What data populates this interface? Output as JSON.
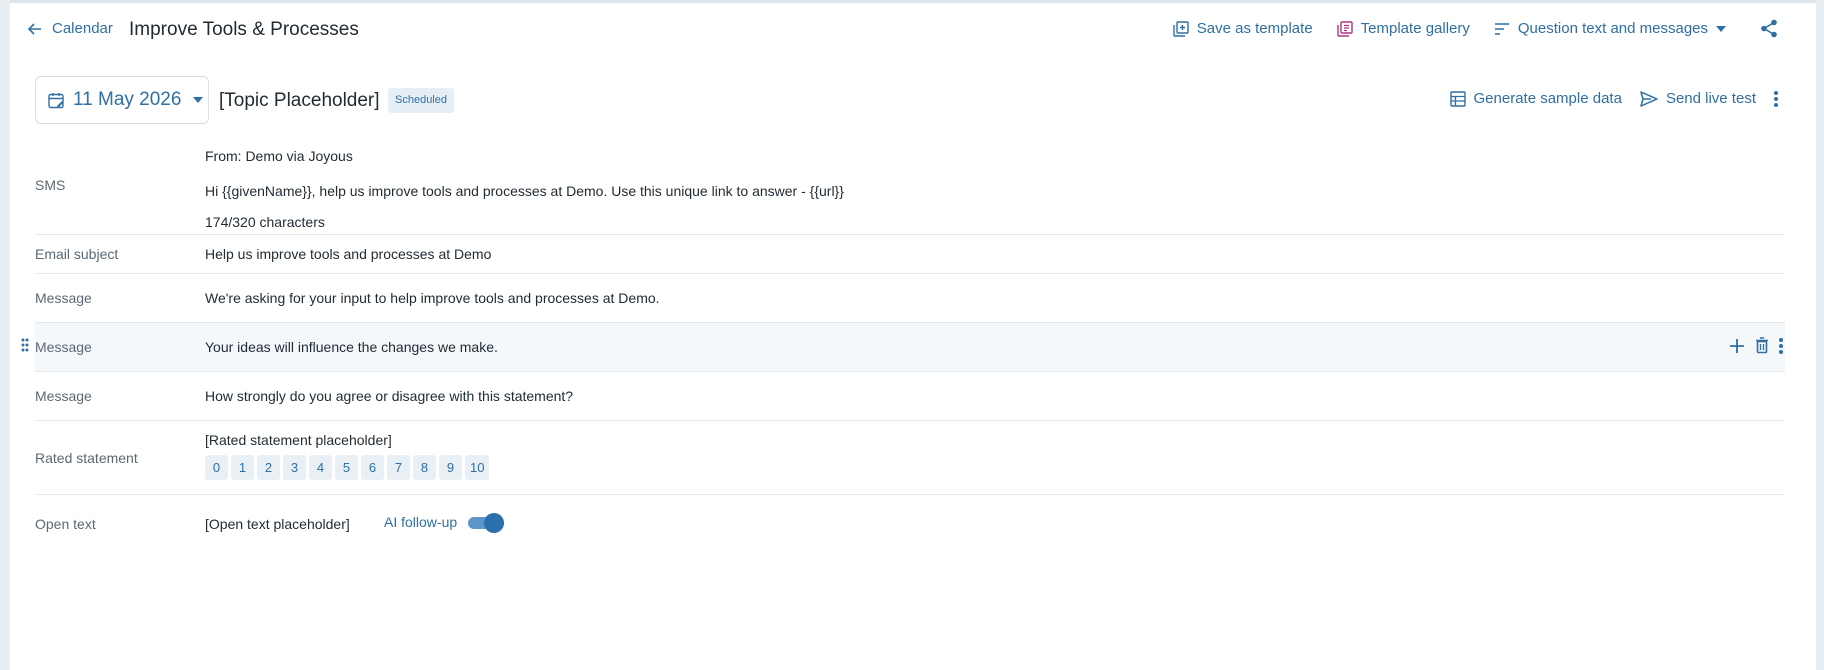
{
  "header": {
    "back_label": "Calendar",
    "title": "Improve Tools & Processes",
    "actions": {
      "save_template": "Save as template",
      "template_gallery": "Template gallery",
      "question_text": "Question text and messages"
    }
  },
  "schedule": {
    "date": "11 May 2026",
    "topic": "[Topic Placeholder]",
    "status": "Scheduled",
    "actions": {
      "generate": "Generate sample data",
      "send": "Send live test"
    }
  },
  "rows": {
    "sms": {
      "label": "SMS",
      "from": "From: Demo via Joyous",
      "text": "Hi {{givenName}}, help us improve tools and processes at Demo. Use this unique link to answer - {{url}}",
      "count": "174/320 characters"
    },
    "email_subject": {
      "label": "Email subject",
      "text": "Help us improve tools and processes at Demo"
    },
    "message1": {
      "label": "Message",
      "text": "We're asking for your input to help improve tools and processes at Demo."
    },
    "message2": {
      "label": "Message",
      "text": "Your ideas will influence the changes we make."
    },
    "message3": {
      "label": "Message",
      "text": "How strongly do you agree or disagree with this statement?"
    },
    "rated": {
      "label": "Rated statement",
      "text": "[Rated statement placeholder]",
      "scale": [
        "0",
        "1",
        "2",
        "3",
        "4",
        "5",
        "6",
        "7",
        "8",
        "9",
        "10"
      ]
    },
    "open": {
      "label": "Open text",
      "text": "[Open text placeholder]",
      "followup_label": "AI follow-up",
      "followup_enabled": true
    }
  },
  "colors": {
    "accent": "#2f6fa3",
    "template_gallery_icon": "#b0327f"
  }
}
